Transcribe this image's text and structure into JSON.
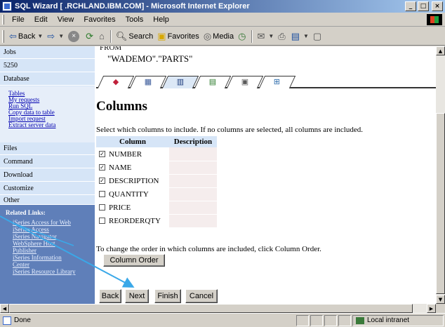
{
  "window": {
    "title": "SQL Wizard [           .RCHLAND.IBM.COM] - Microsoft Internet Explorer",
    "min_glyph": "_",
    "max_glyph": "□",
    "close_glyph": "×"
  },
  "menu": [
    "File",
    "Edit",
    "View",
    "Favorites",
    "Tools",
    "Help"
  ],
  "toolbar": {
    "back_label": "Back",
    "search_label": "Search",
    "favorites_label": "Favorites",
    "media_label": "Media"
  },
  "sidebar": {
    "top_items": [
      "Jobs",
      "5250",
      "Database"
    ],
    "database_links": [
      "Tables",
      "My requests",
      "Run SQL",
      "Copy data to table",
      "Import request",
      "Extract server data"
    ],
    "items": [
      "Files",
      "Command",
      "Download",
      "Customize",
      "Other"
    ],
    "related_heading": "Related Links:",
    "related_links": [
      "iSeries Access for Web",
      "iSeries Access",
      "iSeries Navigator",
      "WebSphere Host",
      "Publisher",
      "iSeries Information",
      "Center",
      "iSeries Resource Library"
    ]
  },
  "main": {
    "from_keyword": "FROM",
    "table_name": "\"WADEMO\".\"PARTS\"",
    "tabs": [
      {
        "icon": "shapes-icon",
        "glyph": "◆"
      },
      {
        "icon": "table-icon",
        "glyph": "▦"
      },
      {
        "icon": "columns-icon",
        "glyph": "▥"
      },
      {
        "icon": "filter-icon",
        "glyph": "▤"
      },
      {
        "icon": "sort-icon",
        "glyph": "▣"
      },
      {
        "icon": "output-icon",
        "glyph": "⊞"
      }
    ],
    "heading": "Columns",
    "instructions": "Select which columns to include. If no columns are selected, all columns are included.",
    "table": {
      "headers": [
        "Column",
        "Description"
      ],
      "rows": [
        {
          "name": "NUMBER",
          "checked": true
        },
        {
          "name": "NAME",
          "checked": true
        },
        {
          "name": "DESCRIPTION",
          "checked": true
        },
        {
          "name": "QUANTITY",
          "checked": false
        },
        {
          "name": "PRICE",
          "checked": false
        },
        {
          "name": "REORDERQTY",
          "checked": false
        }
      ]
    },
    "order_text": "To change the order in which columns are included, click Column Order.",
    "column_order_button": "Column Order",
    "nav_buttons": {
      "back": "Back",
      "next": "Next",
      "finish": "Finish",
      "cancel": "Cancel"
    }
  },
  "status": {
    "text": "Done",
    "zone": "Local intranet"
  },
  "colors": {
    "sidebar_bg": "#d6e5f7",
    "related_bg": "#5f7fb9",
    "callout_arrow": "#3aa8e8",
    "link": "#0000b0"
  }
}
